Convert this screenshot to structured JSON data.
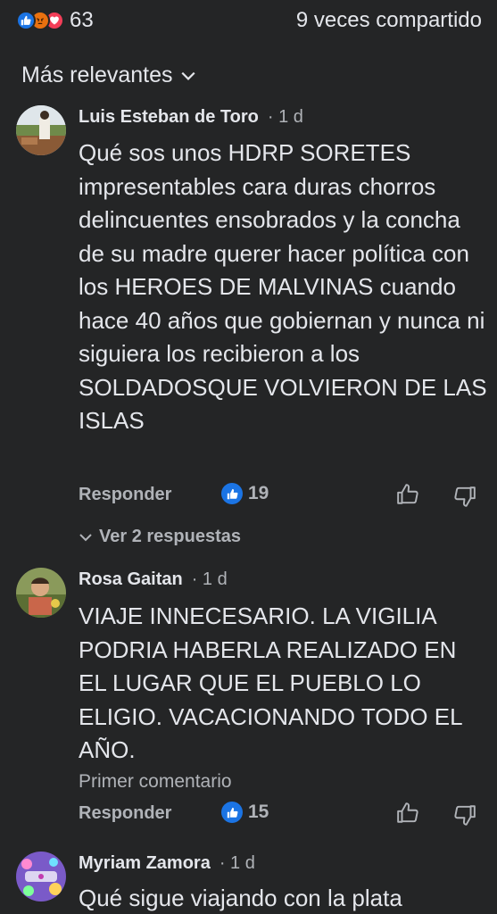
{
  "header": {
    "reaction_count": "63",
    "shares": "9 veces compartido",
    "reaction_icons": [
      "like-icon",
      "angry-icon",
      "love-icon"
    ]
  },
  "sort": {
    "label": "Más relevantes"
  },
  "comments": [
    {
      "name": "Luis Esteban de Toro",
      "time": "· 1 d",
      "text": "Qué sos unos HDRP SORETES impresentables cara duras chorros delincuentes ensobrados y la concha de su madre querer hacer política con los HEROES DE MALVINAS cuando hace 40 años que gobiernan y nunca ni siguiera los recibieron a los SOLDADOSQUE VOLVIERON DE LAS ISLAS",
      "reply_label": "Responder",
      "likes": "19",
      "view_replies": "Ver 2 respuestas"
    },
    {
      "name": "Rosa Gaitan",
      "time": "· 1 d",
      "text": "VIAJE INNECESARIO. LA VIGILIA PODRIA HABERLA REALIZADO EN EL LUGAR QUE EL PUEBLO  LO ELIGIO. VACACIONANDO TODO EL AÑO.",
      "meta": "Primer comentario",
      "reply_label": "Responder",
      "likes": "15"
    },
    {
      "name": "Myriam Zamora",
      "time": "· 1 d",
      "text": "Qué sigue viajando con la plata"
    }
  ],
  "colors": {
    "background": "#242526",
    "text_primary": "#e4e6eb",
    "text_secondary": "#b0b3b8",
    "like_blue": "#1b74e4",
    "angry_orange": "#e9710f",
    "love_red": "#f33e58"
  }
}
